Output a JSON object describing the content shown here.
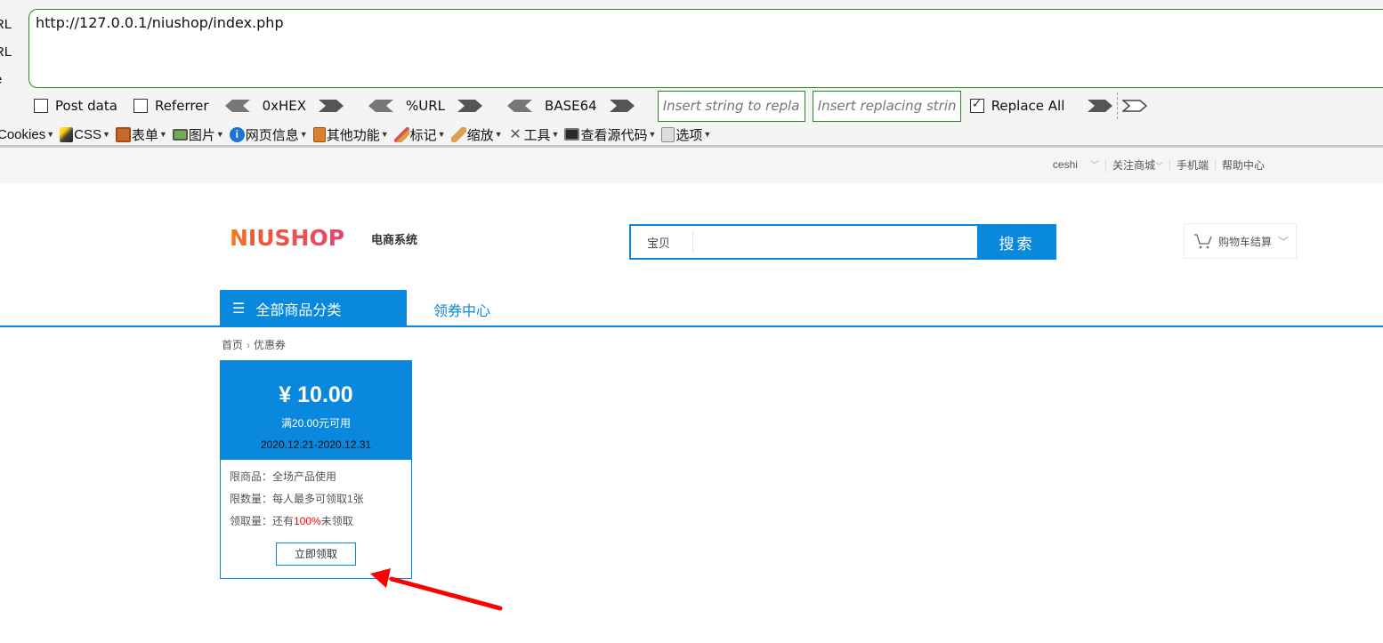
{
  "hackbar": {
    "side_labels": [
      "RL",
      "RL",
      "e"
    ],
    "url_value": "http://127.0.0.1/niushop/index.php",
    "options": {
      "post_data": {
        "label": "Post data",
        "checked": false
      },
      "referrer": {
        "label": "Referrer",
        "checked": false
      }
    },
    "encoders": [
      "0xHEX",
      "%URL",
      "BASE64"
    ],
    "replace_input_placeholder": "Insert string to replace",
    "replacing_input_placeholder": "Insert replacing string",
    "replace_all": {
      "label": "Replace All",
      "checked": true
    }
  },
  "toolbar": {
    "items": [
      {
        "label": "Cookies",
        "icon": "cookie-icon"
      },
      {
        "label": "CSS",
        "icon": "magic-wand-icon"
      },
      {
        "label": "表单",
        "icon": "clipboard-icon"
      },
      {
        "label": "图片",
        "icon": "image-icon"
      },
      {
        "label": "网页信息",
        "icon": "info-icon"
      },
      {
        "label": "其他功能",
        "icon": "book-icon"
      },
      {
        "label": "标记",
        "icon": "pencil-icon"
      },
      {
        "label": "缩放",
        "icon": "ruler-icon"
      },
      {
        "label": "工具",
        "icon": "tools-icon"
      },
      {
        "label": "查看源代码",
        "icon": "terminal-icon"
      },
      {
        "label": "选项",
        "icon": "options-icon"
      }
    ]
  },
  "site": {
    "topbar": {
      "user": "ceshi",
      "links": [
        "关注商城",
        "手机端",
        "帮助中心"
      ]
    },
    "logo": {
      "brand": "NIUSHOP",
      "subtitle": "电商系统"
    },
    "search": {
      "category": "宝贝",
      "value": "",
      "button": "搜索"
    },
    "cart": {
      "label": "购物车结算"
    },
    "nav": {
      "all_categories": "全部商品分类",
      "links": [
        "领券中心"
      ]
    },
    "breadcrumb": [
      "首页",
      "优惠券"
    ],
    "coupon": {
      "amount": "¥ 10.00",
      "condition": "满20.00元可用",
      "validity": "2020.12.21-2020.12.31",
      "limit_goods_label": "限商品：",
      "limit_goods_value": "全场产品使用",
      "limit_qty_label": "限数量：",
      "limit_qty_value": "每人最多可领取1张",
      "received_label": "领取量：",
      "received_prefix": "还有",
      "received_percent": "100%",
      "received_suffix": "未领取",
      "button": "立即领取"
    }
  },
  "colors": {
    "brand_blue": "#0a88dd",
    "hackbar_green": "#2a8a2a",
    "annotation_red": "#ff0000"
  }
}
